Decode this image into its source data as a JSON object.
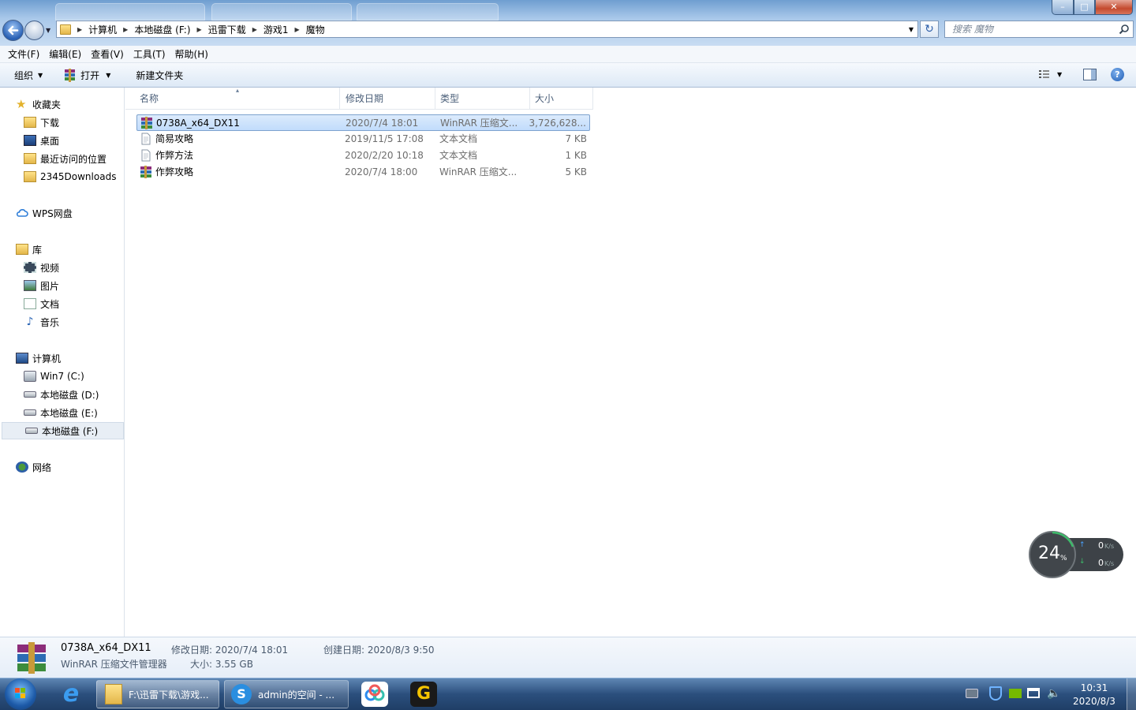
{
  "address": {
    "crumbs": [
      "计算机",
      "本地磁盘 (F:)",
      "迅雷下载",
      "游戏1",
      "魔物"
    ]
  },
  "search": {
    "placeholder": "搜索 魔物"
  },
  "menu": [
    "文件(F)",
    "编辑(E)",
    "查看(V)",
    "工具(T)",
    "帮助(H)"
  ],
  "toolbar": {
    "organize": "组织",
    "open": "打开",
    "new_folder": "新建文件夹"
  },
  "nav": {
    "favorites": "收藏夹",
    "fav_items": [
      "下载",
      "桌面",
      "最近访问的位置",
      "2345Downloads"
    ],
    "wps": "WPS网盘",
    "libraries": "库",
    "lib_items": [
      "视频",
      "图片",
      "文档",
      "音乐"
    ],
    "computer": "计算机",
    "drives": [
      "Win7 (C:)",
      "本地磁盘 (D:)",
      "本地磁盘 (E:)",
      "本地磁盘 (F:)"
    ],
    "network": "网络"
  },
  "columns": {
    "name": "名称",
    "date": "修改日期",
    "type": "类型",
    "size": "大小"
  },
  "files": [
    {
      "name": "0738A_x64_DX11",
      "date": "2020/7/4 18:01",
      "type": "WinRAR 压缩文...",
      "size": "3,726,628..."
    },
    {
      "name": "简易攻略",
      "date": "2019/11/5 17:08",
      "type": "文本文档",
      "size": "7 KB"
    },
    {
      "name": "作弊方法",
      "date": "2020/2/20 10:18",
      "type": "文本文档",
      "size": "1 KB"
    },
    {
      "name": "作弊攻略",
      "date": "2020/7/4 18:00",
      "type": "WinRAR 压缩文...",
      "size": "5 KB"
    }
  ],
  "details": {
    "name": "0738A_x64_DX11",
    "type": "WinRAR 压缩文件管理器",
    "modified": "修改日期: 2020/7/4 18:01",
    "size": "大小: 3.55 GB",
    "created": "创建日期: 2020/8/3 9:50"
  },
  "taskbar": {
    "explorer": "F:\\迅雷下载\\游戏...",
    "browser": "admin的空间 - ...",
    "time": "10:31",
    "date": "2020/8/3"
  },
  "widget": {
    "percent": "24",
    "unit": "%",
    "up": "0",
    "down": "0",
    "rate_unit": "K/s"
  }
}
